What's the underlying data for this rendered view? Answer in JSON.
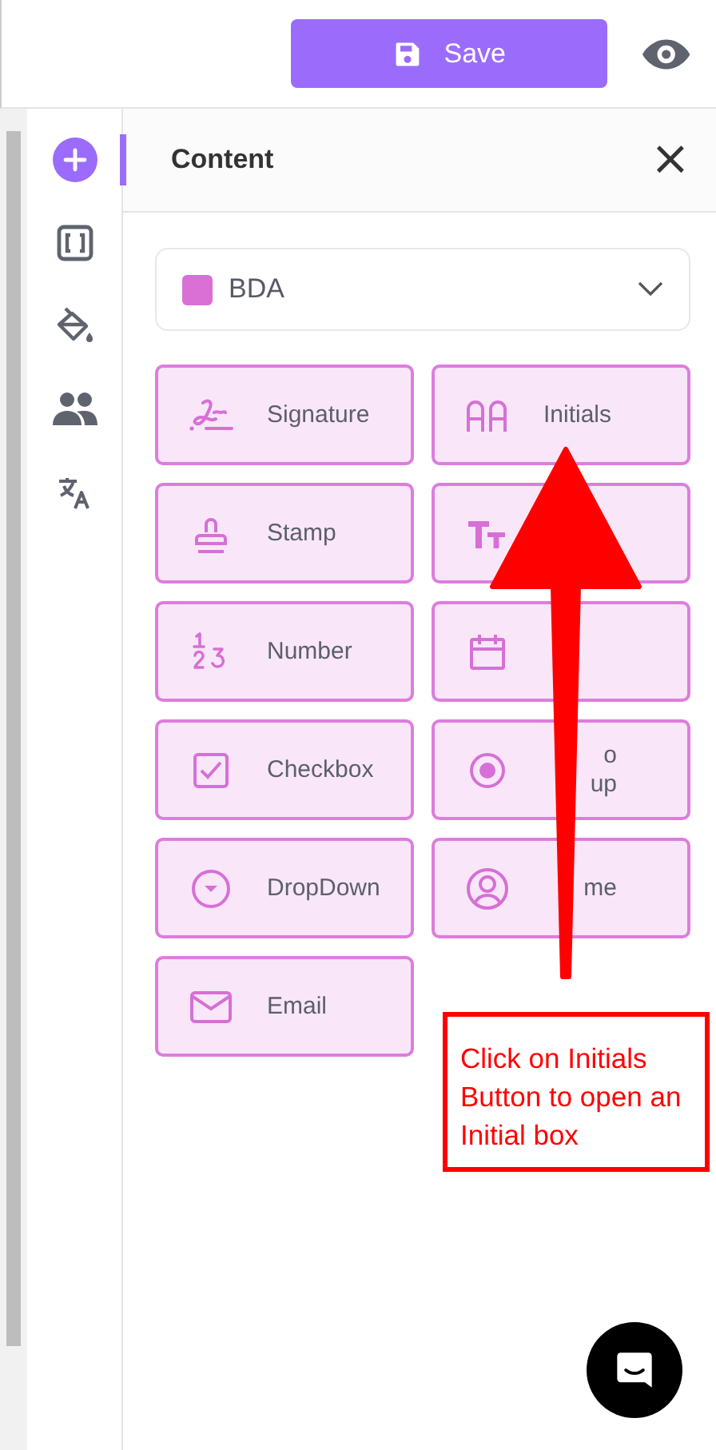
{
  "toolbar": {
    "save_label": "Save"
  },
  "sidebar": {
    "items": [
      {
        "selected": true
      },
      {
        "selected": false
      },
      {
        "selected": false
      },
      {
        "selected": false
      },
      {
        "selected": false
      }
    ]
  },
  "panel": {
    "title": "Content",
    "close": "×"
  },
  "recipient": {
    "value": "BDA",
    "color": "#da6fd6"
  },
  "fields": [
    {
      "kind": "labeled",
      "label": "Signature"
    },
    {
      "kind": "labeled",
      "label": "Initials"
    },
    {
      "kind": "labeled",
      "label": "Stamp"
    },
    {
      "kind": "icon-only"
    },
    {
      "kind": "labeled",
      "label": "Number"
    },
    {
      "kind": "icon-only"
    },
    {
      "kind": "labeled",
      "label": "Checkbox"
    },
    {
      "kind": "partial",
      "lines": [
        "o",
        "up"
      ]
    },
    {
      "kind": "labeled",
      "label": "DropDown"
    },
    {
      "kind": "partial",
      "lines": [
        "me"
      ]
    },
    {
      "kind": "labeled",
      "label": "Email"
    }
  ],
  "annotation": {
    "text": "Click on Initials Button to open an Initial box"
  }
}
